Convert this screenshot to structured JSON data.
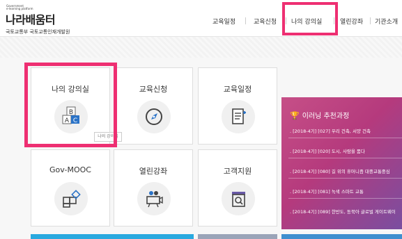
{
  "header": {
    "logo_small_top": "Government",
    "logo_small_bottom": "e-learning platform",
    "logo_main": "나라배움터",
    "logo_sub": "국토교통부 국토교통인재개발원",
    "nav": [
      "교육일정",
      "교육신청",
      "나의 강의실",
      "열린강좌",
      "기관소개"
    ]
  },
  "cards": [
    {
      "title": "나의 강의실",
      "icon": "abc-blocks-icon"
    },
    {
      "title": "교육신청",
      "icon": "compass-icon"
    },
    {
      "title": "교육일정",
      "icon": "document-icon"
    },
    {
      "title": "Gov-MOOC",
      "icon": "shapes-icon"
    },
    {
      "title": "열린강좌",
      "icon": "camera-icon"
    },
    {
      "title": "고객지원",
      "icon": "magnifier-icon"
    }
  ],
  "tooltip": "나의 강의실",
  "recommend": {
    "title": "이러닝 추천과정",
    "items": [
      "[2018-4기] [027] 우리 건축, 서양 건축",
      "[2018-4기] [020] 도시, 사람을 품다",
      "[2018-4기] [080] 길 위의 휴머니즘 대중교통중심",
      "[2018-4기] [081] 녹색 스마트 교통",
      "[2018-4기] [089] 한반도, 동북아 글로벌 게이트웨이"
    ]
  },
  "colors": {
    "accent": "#ee2f72",
    "reco_start": "#c64f87",
    "reco_end": "#7a4ea0",
    "icon_blue": "#2b73c7"
  }
}
